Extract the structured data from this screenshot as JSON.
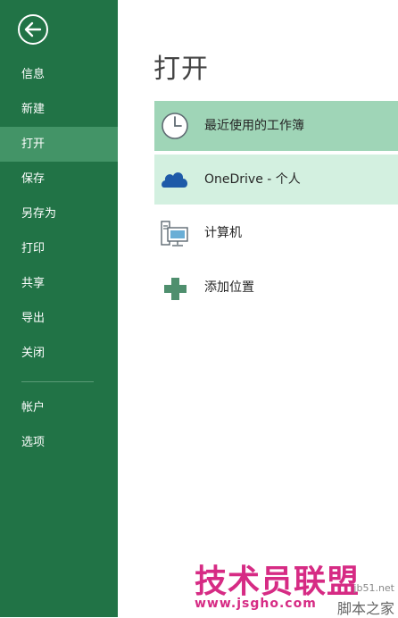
{
  "sidebar": {
    "back_icon": "back-arrow-icon",
    "items": [
      {
        "label": "信息"
      },
      {
        "label": "新建"
      },
      {
        "label": "打开"
      },
      {
        "label": "保存"
      },
      {
        "label": "另存为"
      },
      {
        "label": "打印"
      },
      {
        "label": "共享"
      },
      {
        "label": "导出"
      },
      {
        "label": "关闭"
      }
    ],
    "bottom_items": [
      {
        "label": "帐户"
      },
      {
        "label": "选项"
      }
    ],
    "active_item": "打开",
    "bg_color": "#217346",
    "active_color": "#439467"
  },
  "main": {
    "title": "打开",
    "locations": [
      {
        "label": "最近使用的工作簿",
        "icon": "clock-icon"
      },
      {
        "label": "OneDrive - 个人",
        "icon": "cloud-icon"
      },
      {
        "label": "计算机",
        "icon": "computer-icon"
      },
      {
        "label": "添加位置",
        "icon": "plus-icon"
      }
    ],
    "selected_color": "#9fd5b7",
    "hover_color": "#d3f0e0"
  },
  "watermark": {
    "main": "技术员联盟",
    "url": "www.jsgho.com",
    "small": "jb51.net",
    "corner": "脚本之家"
  }
}
